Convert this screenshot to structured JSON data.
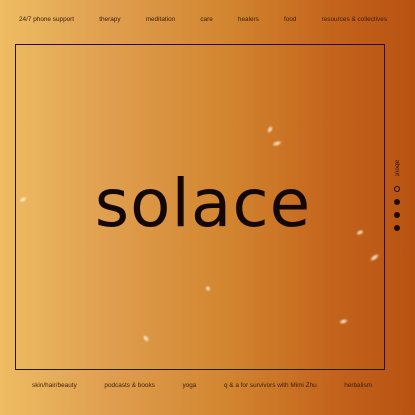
{
  "top_nav": [
    "24/7 phone support",
    "therapy",
    "meditation",
    "care",
    "healers",
    "food",
    "resources & collectives"
  ],
  "bottom_nav": [
    "skin/hair/beauty",
    "podcasts & books",
    "yoga",
    "q & a for survivors with Mimi Zhu",
    "herbalism"
  ],
  "brand": "solace",
  "side": {
    "about_label": "about",
    "slides_total": 4,
    "active_slide": 1
  },
  "colors": {
    "gradient_left": "#eebc62",
    "gradient_right": "#b85212",
    "text": "#130805"
  }
}
